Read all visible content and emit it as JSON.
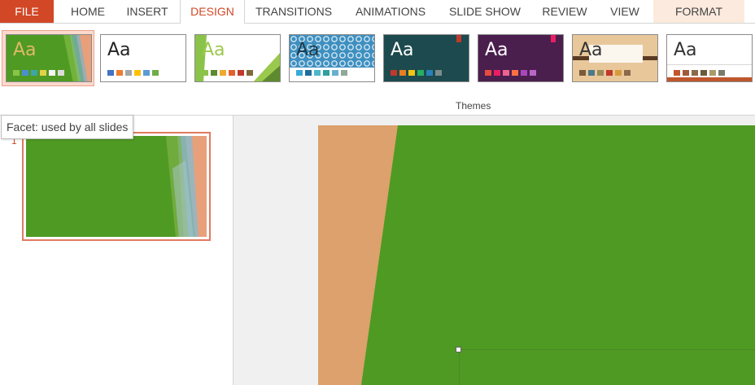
{
  "tabs": {
    "file": "FILE",
    "home": "HOME",
    "insert": "INSERT",
    "design": "DESIGN",
    "transitions": "TRANSITIONS",
    "animations": "ANIMATIONS",
    "slide_show": "SLIDE SHOW",
    "review": "REVIEW",
    "view": "VIEW",
    "format": "FORMAT"
  },
  "themes": {
    "group_label": "Themes",
    "items": [
      {
        "glyph": "Aa",
        "glyph_color": "#e0b86a",
        "bg": "#4f9a23",
        "swatches": [
          "#8bc34a",
          "#4a8fd0",
          "#3ea6a6",
          "#e5d04a",
          "#f5f5f5",
          "#dcdcdc"
        ]
      },
      {
        "glyph": "Aa",
        "glyph_color": "#222222",
        "bg": "#ffffff",
        "swatches": [
          "#4472c4",
          "#ed7d31",
          "#a5a5a5",
          "#ffc000",
          "#5b9bd5",
          "#70ad47"
        ]
      },
      {
        "glyph": "Aa",
        "glyph_color": "#9bc94d",
        "bg": "#ffffff",
        "swatches": [
          "#8bc34a",
          "#5d8a2e",
          "#f0a830",
          "#e2612e",
          "#c0392b",
          "#7f6a3a"
        ]
      },
      {
        "glyph": "Aa",
        "glyph_color": "#1a3a4a",
        "bg": "#3f8fc0",
        "swatches": [
          "#3aa8d8",
          "#1f6d9a",
          "#4bb8c8",
          "#2ea0a0",
          "#68b0d0",
          "#8fa89a"
        ]
      },
      {
        "glyph": "Aa",
        "glyph_color": "#ffffff",
        "bg": "#1d4a4e",
        "swatches": [
          "#c0392b",
          "#e67e22",
          "#f1c40f",
          "#27ae60",
          "#2980b9",
          "#7f8c8d"
        ]
      },
      {
        "glyph": "Aa",
        "glyph_color": "#ffffff",
        "bg": "#4a1f4e",
        "swatches": [
          "#e74c3c",
          "#e91e63",
          "#f06292",
          "#ff7043",
          "#ab47bc",
          "#ba68c8"
        ]
      },
      {
        "glyph": "Aa",
        "glyph_color": "#333333",
        "bg": "#e8c79a",
        "swatches": [
          "#7a5a3a",
          "#4a7a8a",
          "#9a8a5a",
          "#c0392b",
          "#d99a3a",
          "#8a6a4a"
        ]
      },
      {
        "glyph": "Aa",
        "glyph_color": "#333333",
        "bg": "#ffffff",
        "swatches": [
          "#c0562e",
          "#a05a3a",
          "#8a6a4a",
          "#6a5a3a",
          "#a89a6a",
          "#7a7a6a"
        ]
      }
    ]
  },
  "tooltip": {
    "text": "Facet: used by all slides"
  },
  "slide_pane": {
    "number": "1"
  }
}
